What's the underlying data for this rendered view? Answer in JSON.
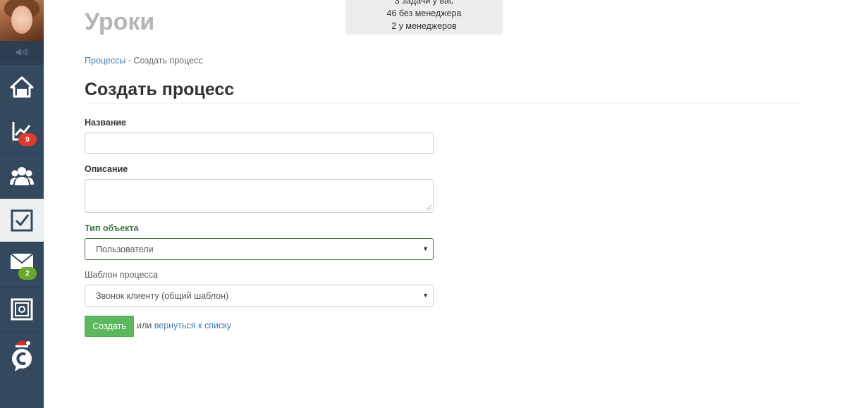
{
  "header": {
    "title": "Уроки"
  },
  "stats": {
    "line1": "3 задачи у вас",
    "line2": "46 без менеджера",
    "line3": "2 у менеджеров"
  },
  "breadcrumb": {
    "link": "Процессы",
    "separator": "-",
    "current": "Создать процесс"
  },
  "form": {
    "heading": "Создать процесс",
    "name_label": "Название",
    "name_value": "",
    "description_label": "Описание",
    "description_value": "",
    "object_type_label": "Тип объекта",
    "object_type_value": "Пользователи",
    "template_label": "Шаблон процесса",
    "template_value": "Звонок клиенту (общий шаблон)",
    "submit_label": "Создать",
    "or_text": "или",
    "back_link": "вернуться к списку"
  },
  "sidebar": {
    "items": [
      {
        "icon": "home-icon"
      },
      {
        "icon": "chart-icon",
        "badge": "9"
      },
      {
        "icon": "users-icon"
      },
      {
        "icon": "checkbox-icon"
      },
      {
        "icon": "mail-icon",
        "badge": "2"
      },
      {
        "icon": "safe-icon"
      },
      {
        "icon": "logo-icon"
      }
    ]
  },
  "colors": {
    "sidebar": "#34495e",
    "accent_green": "#5cb85c",
    "link": "#3f7ab7",
    "badge_red": "#e03a2f",
    "badge_green": "#6aa82a"
  }
}
